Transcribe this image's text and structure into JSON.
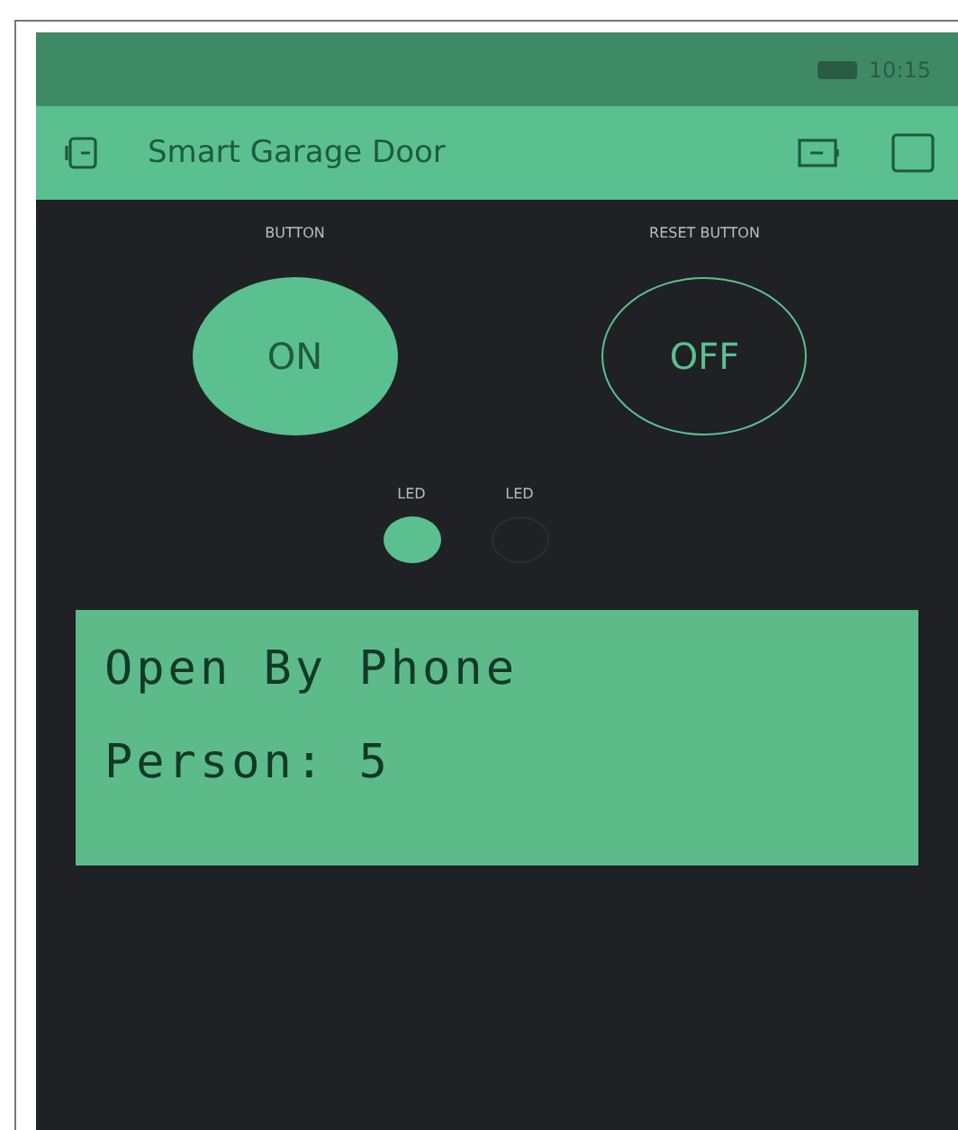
{
  "status_bar": {
    "time": "10:15"
  },
  "app_bar": {
    "title": "Smart Garage Door"
  },
  "buttons": [
    {
      "label": "BUTTON",
      "text": "ON",
      "on": true
    },
    {
      "label": "RESET BUTTON",
      "text": "OFF",
      "on": false
    }
  ],
  "leds": [
    {
      "label": "LED",
      "on": true
    },
    {
      "label": "LED",
      "on": false
    }
  ],
  "lcd": {
    "lines": [
      "Open By Phone",
      "Person: 5"
    ]
  }
}
